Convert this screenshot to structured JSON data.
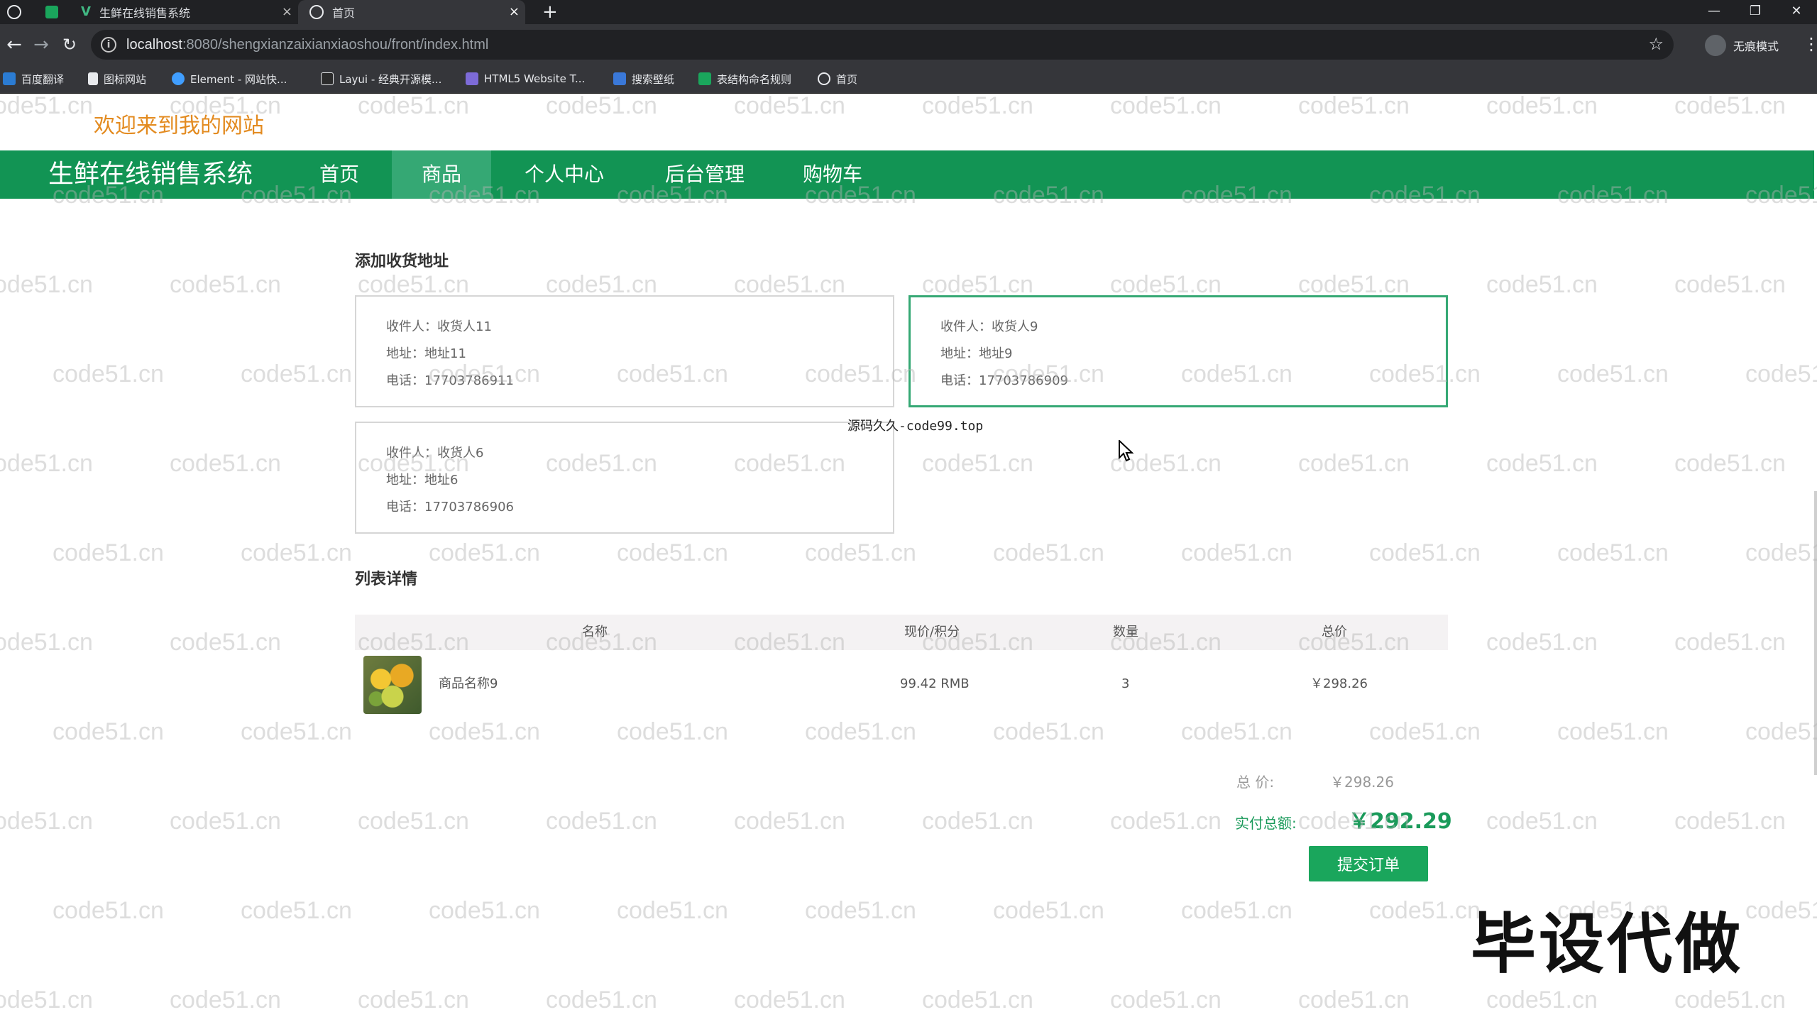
{
  "browser": {
    "tabs": [
      {
        "title": "生鲜在线销售系统",
        "close": "×"
      },
      {
        "title": "首页",
        "close": "×"
      }
    ],
    "new_tab": "+",
    "window_controls": [
      "—",
      "❐",
      "✕"
    ],
    "url_host": "localhost",
    "url_path": ":8080/shengxianzaixianxiaoshou/front/index.html",
    "profile": "无痕模式",
    "bookmarks": [
      "百度翻译",
      "图标网站",
      "Element - 网站快...",
      "Layui - 经典开源模...",
      "HTML5 Website T...",
      "搜索壁纸",
      "表结构命名规则",
      "首页"
    ]
  },
  "header": {
    "welcome": "欢迎来到我的网站",
    "brand": "生鲜在线销售系统",
    "nav": [
      "首页",
      "商品",
      "个人中心",
      "后台管理",
      "购物车"
    ],
    "active_nav": "商品"
  },
  "address_section": {
    "title": "添加收货地址",
    "cards": [
      {
        "receiver": "收件人：收货人11",
        "address": "地址：地址11",
        "phone": "电话：17703786911",
        "selected": false
      },
      {
        "receiver": "收件人：收货人9",
        "address": "地址：地址9",
        "phone": "电话：17703786909",
        "selected": true
      },
      {
        "receiver": "收件人：收货人6",
        "address": "地址：地址6",
        "phone": "电话：17703786906",
        "selected": false
      }
    ]
  },
  "list_section": {
    "title": "列表详情",
    "columns": [
      "名称",
      "现价/积分",
      "数量",
      "总价"
    ],
    "rows": [
      {
        "name": "商品名称9",
        "price": "99.42 RMB",
        "qty": "3",
        "total": "￥298.26"
      }
    ]
  },
  "summary": {
    "total_label": "总   价:",
    "total_value": "￥298.26",
    "pay_label": "实付总额:",
    "pay_value": "￥292.29",
    "submit_label": "提交订单"
  },
  "overlays": {
    "watermark": "code51.cn",
    "center_text": "源码久久-code99.top",
    "corner_stamp": "毕设代做"
  },
  "colors": {
    "brand_green": "#129454",
    "active_nav": "#35a874",
    "accent_green": "#1aa65c",
    "welcome_orange": "#e38b20"
  }
}
